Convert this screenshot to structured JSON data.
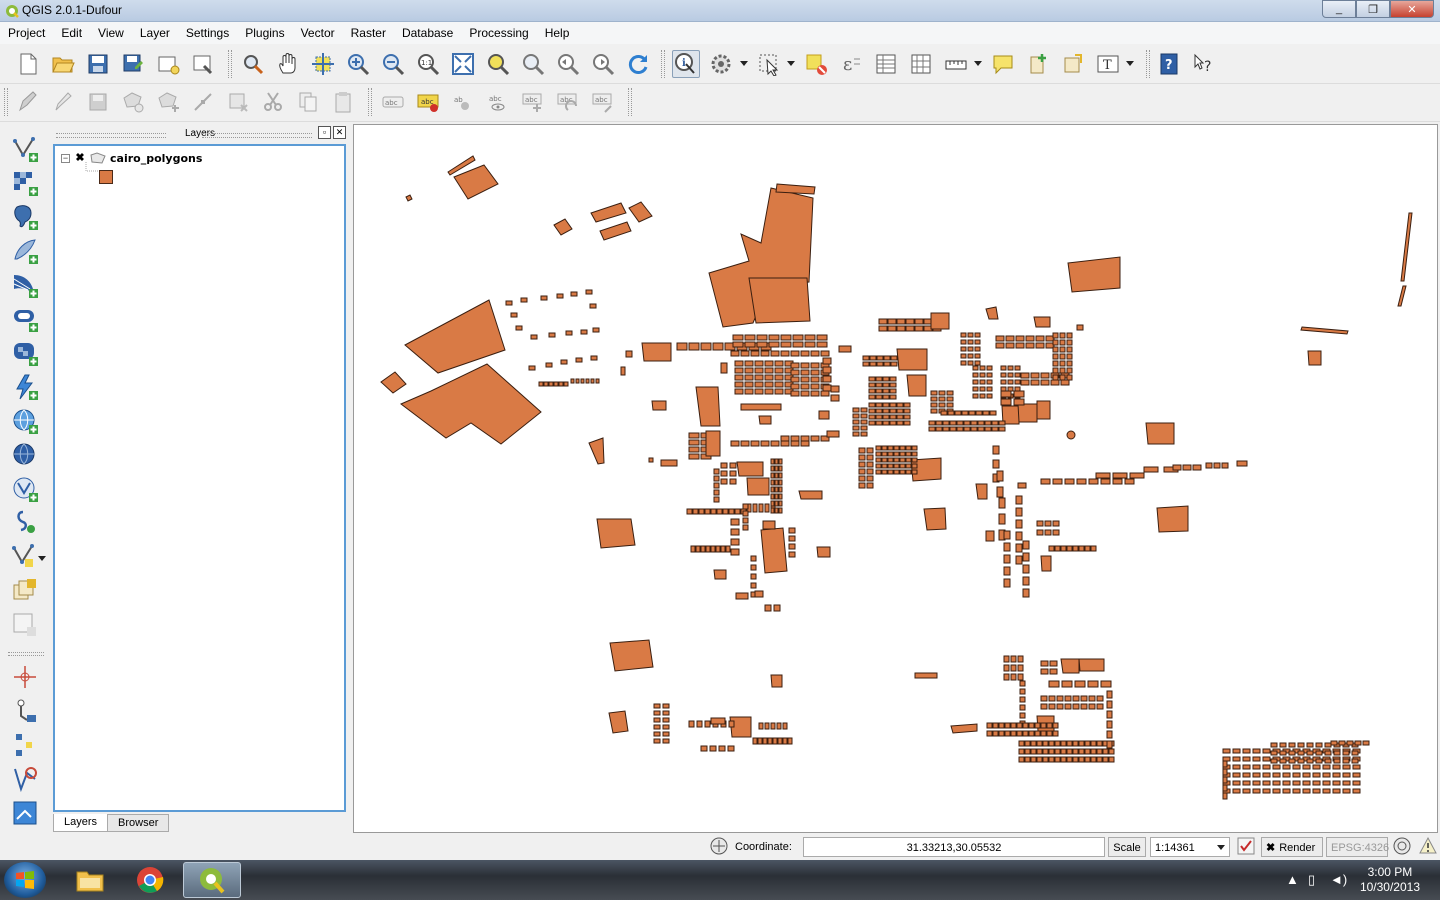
{
  "window": {
    "title": "QGIS 2.0.1-Dufour",
    "controls": [
      "_",
      "❐",
      "✕"
    ]
  },
  "menu": [
    "Project",
    "Edit",
    "View",
    "Layer",
    "Settings",
    "Plugins",
    "Vector",
    "Raster",
    "Database",
    "Processing",
    "Help"
  ],
  "layers_panel": {
    "title": "Layers",
    "layer_name": "cairo_polygons",
    "expander": "−",
    "checkbox": "✖",
    "tabs": [
      "Layers",
      "Browser"
    ]
  },
  "statusbar": {
    "coordinate_label": "Coordinate:",
    "coordinate_value": "31.33213,30.05532",
    "scale_label": "Scale",
    "scale_value": "1:14361",
    "render_label": "Render",
    "render_check": "✖",
    "crs": "EPSG:4326"
  },
  "taskbar": {
    "time": "3:00 PM",
    "date": "10/30/2013"
  },
  "colors": {
    "polygon_fill": "#d97a45",
    "polygon_stroke": "#3b1f10",
    "selection_border": "#5b9bd5"
  }
}
